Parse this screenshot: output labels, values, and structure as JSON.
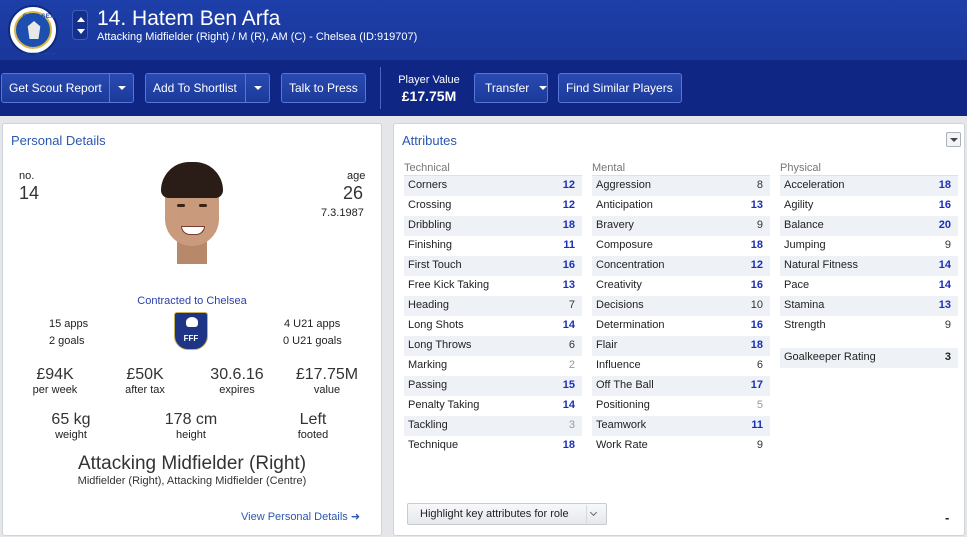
{
  "header": {
    "club_badge_text": "CHELSEA",
    "club_badge_sub": "FOOTBALL CLUB",
    "title": "14. Hatem Ben Arfa",
    "subtitle": "Attacking Midfielder (Right) / M (R), AM (C) - Chelsea (ID:919707)"
  },
  "toolbar": {
    "scout_report": "Get Scout Report",
    "add_shortlist": "Add To Shortlist",
    "talk_press": "Talk to Press",
    "player_value_label": "Player Value",
    "player_value": "£17.75M",
    "transfer": "Transfer",
    "find_similar": "Find Similar Players"
  },
  "personal": {
    "title": "Personal Details",
    "no_label": "no.",
    "no_value": "14",
    "age_label": "age",
    "age_value": "26",
    "dob": "7.3.1987",
    "contract": "Contracted to Chelsea",
    "apps": "15 apps",
    "goals": "2 goals",
    "u21_apps": "4 U21 apps",
    "u21_goals": "0 U21 goals",
    "nation_badge": "FFF",
    "wage": "£94K",
    "wage_label": "per week",
    "after_tax": "£50K",
    "after_tax_label": "after tax",
    "expires": "30.6.16",
    "expires_label": "expires",
    "value": "£17.75M",
    "value_label": "value",
    "weight": "65 kg",
    "weight_label": "weight",
    "height": "178 cm",
    "height_label": "height",
    "foot": "Left",
    "foot_label": "footed",
    "position": "Attacking Midfielder (Right)",
    "positions_sub": "Midfielder (Right), Attacking Midfielder (Centre)",
    "view_link": "View Personal Details ➜"
  },
  "attributes": {
    "title": "Attributes",
    "technical": {
      "heading": "Technical",
      "rows": [
        {
          "name": "Corners",
          "value": "12",
          "level": "hi"
        },
        {
          "name": "Crossing",
          "value": "12",
          "level": "hi"
        },
        {
          "name": "Dribbling",
          "value": "18",
          "level": "hi"
        },
        {
          "name": "Finishing",
          "value": "11",
          "level": "hi"
        },
        {
          "name": "First Touch",
          "value": "16",
          "level": "hi"
        },
        {
          "name": "Free Kick Taking",
          "value": "13",
          "level": "hi"
        },
        {
          "name": "Heading",
          "value": "7",
          "level": "mid"
        },
        {
          "name": "Long Shots",
          "value": "14",
          "level": "hi"
        },
        {
          "name": "Long Throws",
          "value": "6",
          "level": "mid"
        },
        {
          "name": "Marking",
          "value": "2",
          "level": "lo"
        },
        {
          "name": "Passing",
          "value": "15",
          "level": "hi"
        },
        {
          "name": "Penalty Taking",
          "value": "14",
          "level": "hi"
        },
        {
          "name": "Tackling",
          "value": "3",
          "level": "lo"
        },
        {
          "name": "Technique",
          "value": "18",
          "level": "hi"
        }
      ]
    },
    "mental": {
      "heading": "Mental",
      "rows": [
        {
          "name": "Aggression",
          "value": "8",
          "level": "mid"
        },
        {
          "name": "Anticipation",
          "value": "13",
          "level": "hi"
        },
        {
          "name": "Bravery",
          "value": "9",
          "level": "mid"
        },
        {
          "name": "Composure",
          "value": "18",
          "level": "hi"
        },
        {
          "name": "Concentration",
          "value": "12",
          "level": "hi"
        },
        {
          "name": "Creativity",
          "value": "16",
          "level": "hi"
        },
        {
          "name": "Decisions",
          "value": "10",
          "level": "mid"
        },
        {
          "name": "Determination",
          "value": "16",
          "level": "hi"
        },
        {
          "name": "Flair",
          "value": "18",
          "level": "hi"
        },
        {
          "name": "Influence",
          "value": "6",
          "level": "mid"
        },
        {
          "name": "Off The Ball",
          "value": "17",
          "level": "hi"
        },
        {
          "name": "Positioning",
          "value": "5",
          "level": "lo"
        },
        {
          "name": "Teamwork",
          "value": "11",
          "level": "hi"
        },
        {
          "name": "Work Rate",
          "value": "9",
          "level": "mid"
        }
      ]
    },
    "physical": {
      "heading": "Physical",
      "rows": [
        {
          "name": "Acceleration",
          "value": "18",
          "level": "hi"
        },
        {
          "name": "Agility",
          "value": "16",
          "level": "hi"
        },
        {
          "name": "Balance",
          "value": "20",
          "level": "hi"
        },
        {
          "name": "Jumping",
          "value": "9",
          "level": "mid"
        },
        {
          "name": "Natural Fitness",
          "value": "14",
          "level": "hi"
        },
        {
          "name": "Pace",
          "value": "14",
          "level": "hi"
        },
        {
          "name": "Stamina",
          "value": "13",
          "level": "hi"
        },
        {
          "name": "Strength",
          "value": "9",
          "level": "mid"
        }
      ],
      "gk_label": "Goalkeeper Rating",
      "gk_value": "3"
    },
    "highlight_button": "Highlight key attributes for role",
    "footer_dash": "-"
  }
}
